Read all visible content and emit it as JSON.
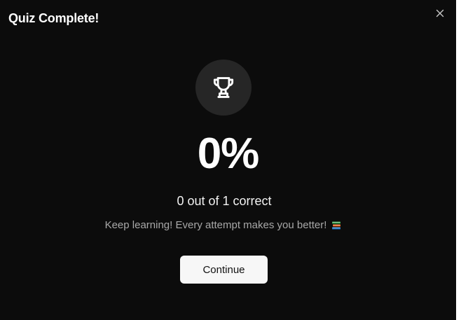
{
  "dialog": {
    "title": "Quiz Complete!",
    "close_icon": "close-icon",
    "trophy_icon": "trophy-icon",
    "percentage": "0%",
    "score_text": "0 out of 1 correct",
    "message": "Keep learning! Every attempt makes you better!",
    "message_icon": "books-icon",
    "continue_label": "Continue"
  },
  "colors": {
    "background": "#0c0c0c",
    "trophy_circle": "#262626",
    "button_bg": "#f7f7f7",
    "muted_text": "#a8a8a8"
  }
}
